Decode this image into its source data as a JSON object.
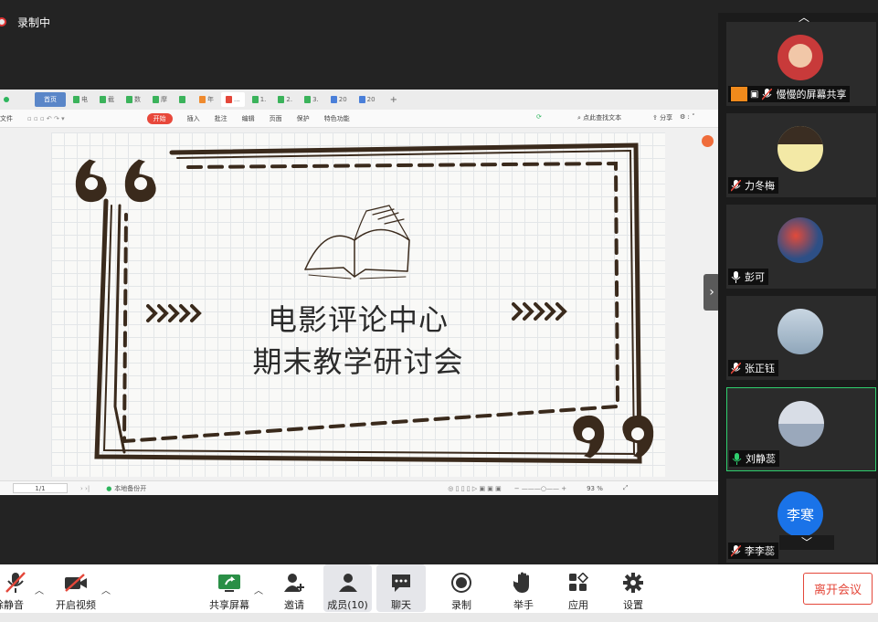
{
  "recording": {
    "label": "录制中"
  },
  "shared_doc": {
    "tabs": [
      "首页",
      "电",
      "截",
      "数",
      "摩",
      "",
      "年",
      "...",
      "1.",
      "2.",
      "3.",
      "20",
      "20"
    ],
    "ribbon": {
      "file": "文件",
      "start": "开始",
      "insert": "插入",
      "annotate": "批注",
      "edit": "编辑",
      "page": "页面",
      "protect": "保护",
      "special": "特色功能",
      "search": "点此查找文本",
      "share": "分享"
    },
    "slide": {
      "line1": "电影评论中心",
      "line2": "期末教学研讨会"
    },
    "status": {
      "page": "1/1",
      "note": "本地备份开",
      "zoom": "93 %"
    }
  },
  "participants": [
    {
      "name": "慢慢的屏幕共享",
      "mic": "muted",
      "sharing": true,
      "avatar_color": "#c83a3a"
    },
    {
      "name": "力冬梅",
      "mic": "muted",
      "sharing": false,
      "avatar_color": "#f3e9a6"
    },
    {
      "name": "彭可",
      "mic": "on",
      "sharing": false,
      "avatar_color": "#2d4f86"
    },
    {
      "name": "张正钰",
      "mic": "muted",
      "sharing": false,
      "avatar_color": "#9fb4c8"
    },
    {
      "name": "刘静蕊",
      "mic": "active",
      "sharing": false,
      "avatar_color": "#b7c3d4"
    },
    {
      "name": "李李蕊",
      "mic": "muted",
      "sharing": false,
      "avatar_text": "李寒",
      "avatar_color": "#1a73e8"
    }
  ],
  "toolbar": {
    "unmute": "解除静音",
    "video": "开启视频",
    "share": "共享屏幕",
    "invite": "邀请",
    "members": "成员(10)",
    "chat": "聊天",
    "record": "录制",
    "raise_hand": "举手",
    "apps": "应用",
    "settings": "设置",
    "leave": "离开会议"
  },
  "colors": {
    "accent_red": "#e4473a",
    "speaking_green": "#2fcf6e"
  }
}
